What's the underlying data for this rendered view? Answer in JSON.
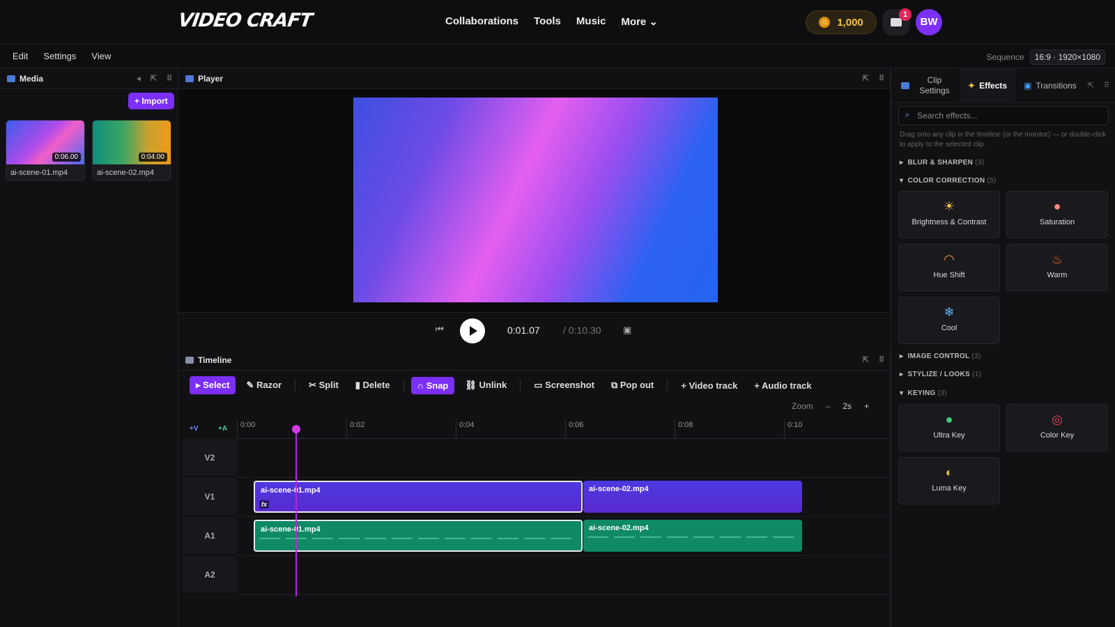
{
  "brand": {
    "logo": "VIDEO CRAFT"
  },
  "nav": [
    "Collaborations",
    "Tools",
    "Music",
    "More ⌄"
  ],
  "account": {
    "coins": "1,000",
    "notifications": "1",
    "initials": "BW"
  },
  "menu": [
    "Edit",
    "Settings",
    "View"
  ],
  "sequence": {
    "label": "Sequence",
    "value": "16:9 · 1920×1080"
  },
  "media": {
    "title": "Media",
    "import_label": "+ Import",
    "items": [
      {
        "name": "ai-scene-01.mp4",
        "duration": "0:06.00"
      },
      {
        "name": "ai-scene-02.mp4",
        "duration": "0:04.00"
      }
    ]
  },
  "player": {
    "title": "Player",
    "current_time": "0:01.07",
    "total_time": "/ 0:10.30"
  },
  "timeline": {
    "title": "Timeline",
    "tools": [
      "Select",
      "Razor",
      "Split",
      "Delete",
      "Snap",
      "Unlink",
      "Screenshot",
      "Pop out",
      "+ Video track",
      "+ Audio track"
    ],
    "zoom_label": "Zoom",
    "zoom_minus": "–",
    "zoom_value": "2s",
    "zoom_plus": "+",
    "add_video": "+V",
    "add_audio": "+A",
    "ruler": [
      "0:00",
      "0:02",
      "0:04",
      "0:06",
      "0:08",
      "0:10"
    ],
    "tracks": [
      "V2",
      "V1",
      "A1",
      "A2"
    ],
    "clips": {
      "v1_a": "ai-scene-01.mp4",
      "v1_b": "ai-scene-02.mp4",
      "a1_a": "ai-scene-01.mp4",
      "a1_b": "ai-scene-02.mp4",
      "fx_badge": "fx"
    }
  },
  "effects": {
    "tabs": [
      "Clip Settings",
      "Effects",
      "Transitions"
    ],
    "search_placeholder": "Search effects...",
    "hint": "Drag onto any clip in the timeline (or the monitor) — or double-click to apply to the selected clip.",
    "categories": [
      {
        "name": "BLUR & SHARPEN",
        "count": "(3)"
      },
      {
        "name": "COLOR CORRECTION",
        "count": "(5)"
      },
      {
        "name": "IMAGE CONTROL",
        "count": "(3)"
      },
      {
        "name": "STYLIZE / LOOKS",
        "count": "(1)"
      },
      {
        "name": "KEYING",
        "count": "(3)"
      }
    ],
    "color_correction": [
      "Brightness & Contrast",
      "Saturation",
      "Hue Shift",
      "Warm",
      "Cool"
    ],
    "keying": [
      "Ultra Key",
      "Color Key",
      "Luma Key"
    ]
  }
}
